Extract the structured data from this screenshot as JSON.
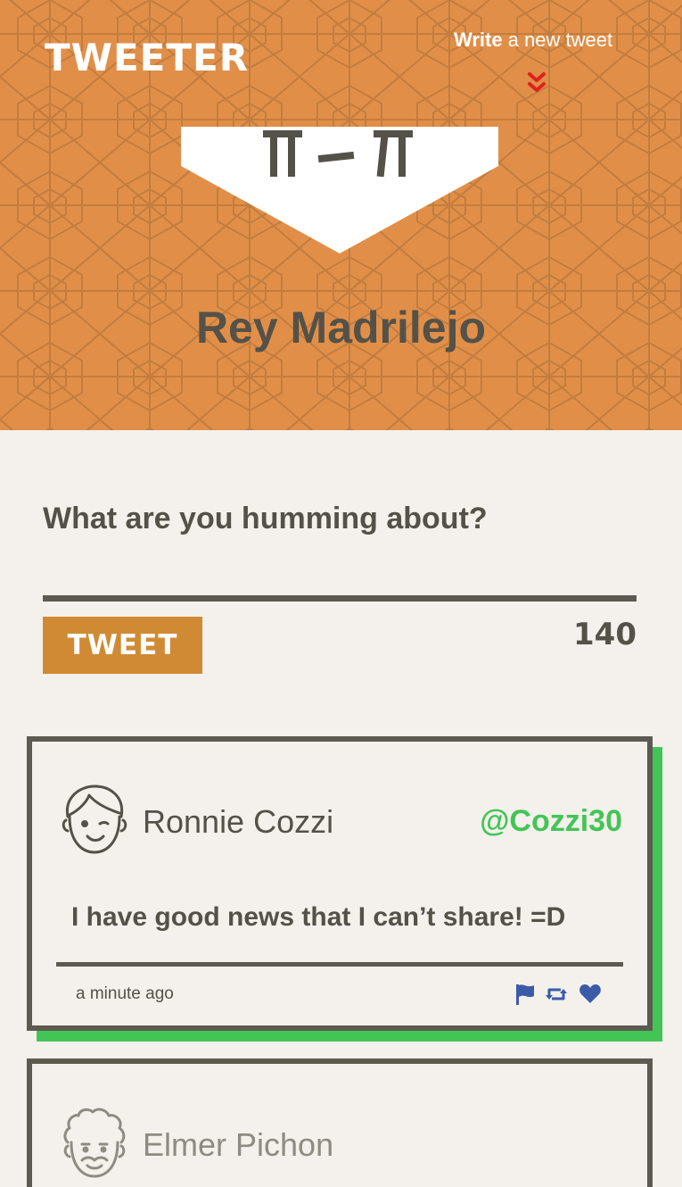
{
  "colors": {
    "header_bg": "#e18f48",
    "pattern_line": "#b8763c",
    "text_dark": "#545149",
    "accent_green": "#43c556",
    "button_bg": "#d18a34",
    "icon_blue": "#3b5ba8",
    "chevron_red": "#e02020",
    "page_bg": "#f4f1ec"
  },
  "header": {
    "logo": "TWEETER",
    "write_bold": "Write",
    "write_rest": " a new tweet",
    "chevron_icon": "double-chevron-down-icon"
  },
  "profile": {
    "name": "Rey Madrilejo"
  },
  "composer": {
    "prompt": "What are you humming about?",
    "button_label": "TWEET",
    "counter": "140"
  },
  "tweets": [
    {
      "name": "Ronnie Cozzi",
      "handle": "@Cozzi30",
      "text": "I have good news that I can’t share! =D",
      "time": "a minute ago",
      "avatar_icon": "boy-avatar-icon",
      "actions": [
        "flag-icon",
        "retweet-icon",
        "heart-icon"
      ]
    },
    {
      "name": "Elmer Pichon",
      "avatar_icon": "curly-hair-avatar-icon"
    }
  ]
}
